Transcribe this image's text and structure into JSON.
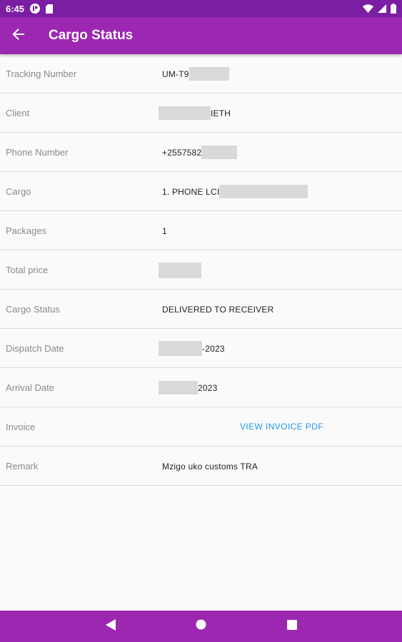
{
  "status_bar": {
    "time": "6:45",
    "icons": [
      "pushbullet-icon",
      "sd-card-icon",
      "wifi-icon",
      "signal-icon",
      "battery-icon"
    ]
  },
  "app_bar": {
    "title": "Cargo Status",
    "back_icon": "arrow-back-icon"
  },
  "colors": {
    "status_bar": "#7b1fa2",
    "app_bar": "#9c27b0",
    "link": "#2196f3",
    "label": "#8a8a8a",
    "divider": "#dcdcdc"
  },
  "rows": [
    {
      "label": "Tracking Number",
      "value_prefix": "UM-T9",
      "value_suffix": ""
    },
    {
      "label": "Client",
      "value_prefix": "",
      "value_suffix": "IETH"
    },
    {
      "label": "Phone Number",
      "value_prefix": "+2557582",
      "value_suffix": ""
    },
    {
      "label": "Cargo",
      "value_prefix": "1. PHONE LCI",
      "value_suffix": ""
    },
    {
      "label": "Packages",
      "value_prefix": "1",
      "value_suffix": ""
    },
    {
      "label": "Total price",
      "value_prefix": "",
      "value_suffix": ""
    },
    {
      "label": "Cargo Status",
      "value_prefix": "DELIVERED TO RECEIVER",
      "value_suffix": ""
    },
    {
      "label": "Dispatch Date",
      "value_prefix": "",
      "value_suffix": "-2023"
    },
    {
      "label": "Arrival Date",
      "value_prefix": "",
      "value_suffix": "2023"
    },
    {
      "label": "Invoice",
      "link_text": "VIEW INVOICE PDF"
    },
    {
      "label": "Remark",
      "value_prefix": "Mzigo uko customs TRA",
      "value_suffix": ""
    }
  ],
  "nav_bar": {
    "buttons": [
      "back-triangle-icon",
      "home-circle-icon",
      "recents-square-icon"
    ]
  }
}
